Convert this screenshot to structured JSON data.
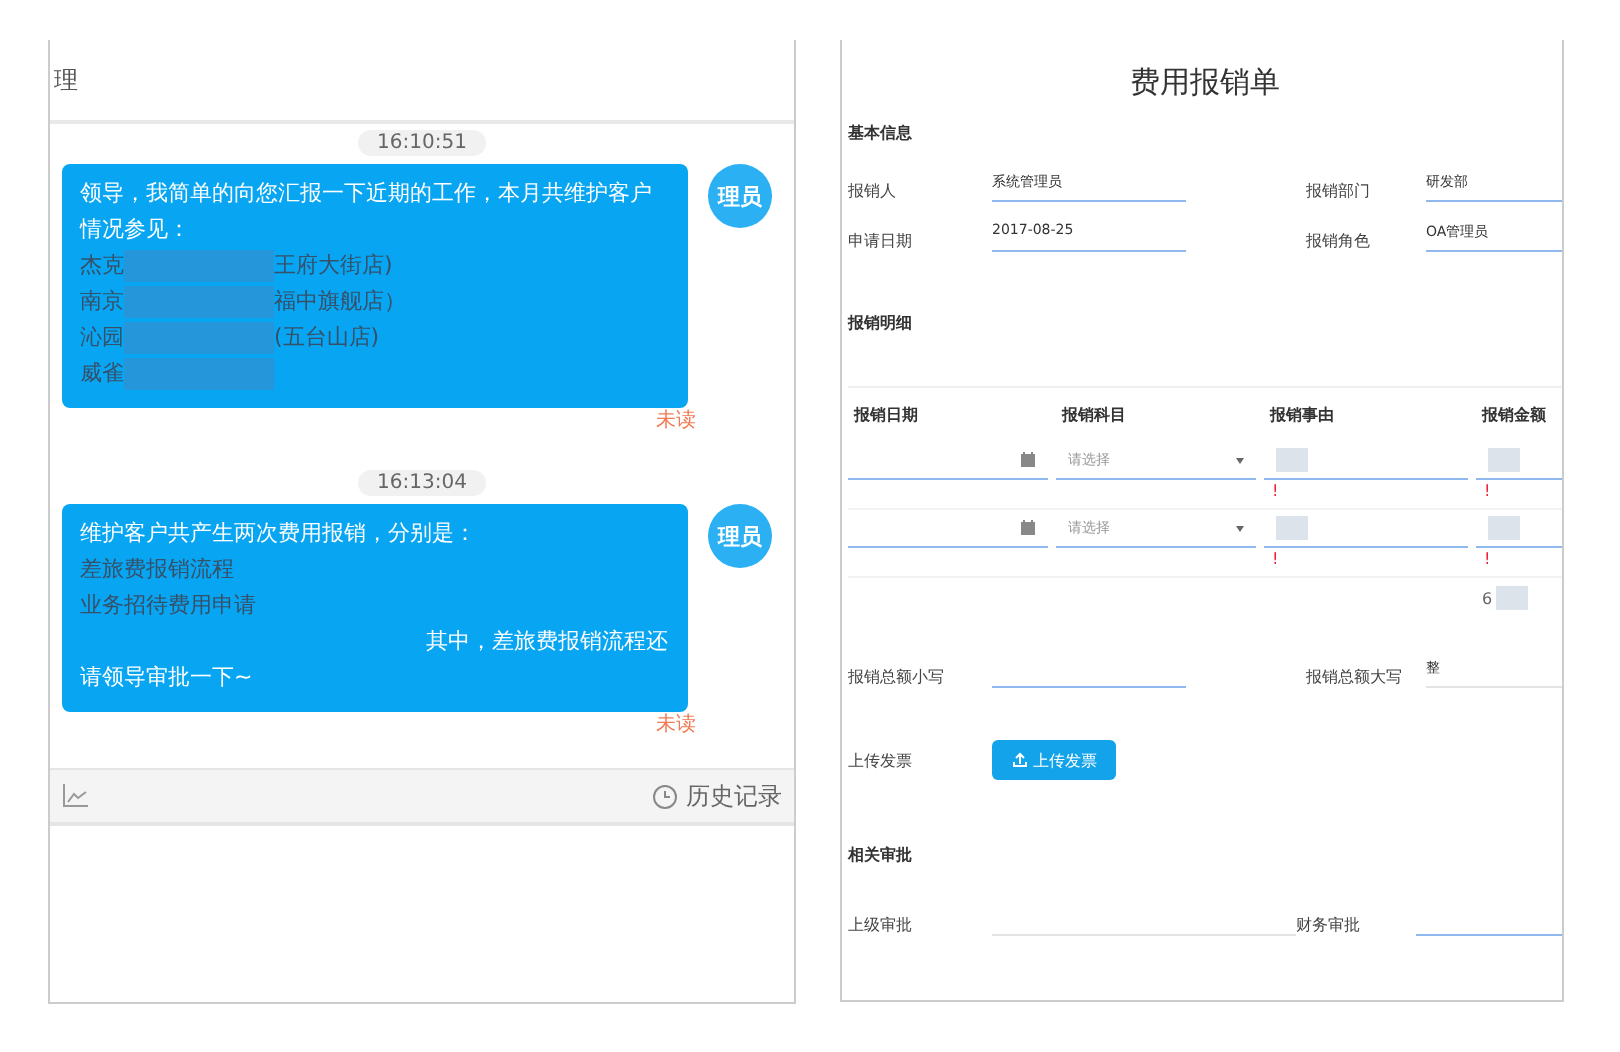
{
  "chat": {
    "title": "理",
    "messages": [
      {
        "time": "16:10:51",
        "avatar": "理员",
        "status": "未读",
        "lines": [
          {
            "kind": "plain",
            "text": "领导，我简单的向您汇报一下近期的工作，本月共维护客户情况参见："
          },
          {
            "kind": "redacted",
            "before": "杰克",
            "after": "王府大街店)"
          },
          {
            "kind": "redacted",
            "before": "南京",
            "after": "福中旗舰店）"
          },
          {
            "kind": "redacted",
            "before": "沁园",
            "after": "(五台山店)"
          },
          {
            "kind": "redacted",
            "before": "威雀"
          }
        ]
      },
      {
        "time": "16:13:04",
        "avatar": "理员",
        "status": "未读",
        "lines": [
          {
            "kind": "plain",
            "text": "维护客户共产生两次费用报销，分别是："
          },
          {
            "kind": "item",
            "text": "差旅费报销流程"
          },
          {
            "kind": "item",
            "text": "业务招待费用申请"
          },
          {
            "kind": "right",
            "text": "其中，差旅费报销流程还"
          },
          {
            "kind": "plain",
            "text": "请领导审批一下~"
          }
        ]
      }
    ],
    "history": "历史记录"
  },
  "form": {
    "title": "费用报销单",
    "basic": {
      "heading": "基本信息",
      "fields": [
        {
          "label": "报销人",
          "value": "系统管理员",
          "readonly": false
        },
        {
          "label": "报销部门",
          "value": "研发部",
          "readonly": false
        },
        {
          "label": "申请日期",
          "value": "2017-08-25",
          "readonly": false
        },
        {
          "label": "报销角色",
          "value": "OA管理员",
          "readonly": false
        }
      ]
    },
    "detail": {
      "heading": "报销明细",
      "columns": [
        "报销日期",
        "报销科目",
        "报销事由",
        "报销金额"
      ],
      "rows": [
        {
          "subject_placeholder": "请选择",
          "reason_error": "!",
          "amount_error": "!"
        },
        {
          "subject_placeholder": "请选择",
          "reason_error": "!",
          "amount_error": "!"
        }
      ],
      "total": "6"
    },
    "totals": [
      {
        "label": "报销总额小写",
        "readonly": false
      },
      {
        "label": "报销总额大写",
        "value": "整",
        "readonly": true
      }
    ],
    "upload": {
      "label": "上传发票",
      "button": "上传发票"
    },
    "approval": {
      "heading": "相关审批",
      "fields": [
        {
          "label": "上级审批",
          "readonly": true
        },
        {
          "label": "财务审批",
          "readonly": false
        }
      ]
    }
  }
}
